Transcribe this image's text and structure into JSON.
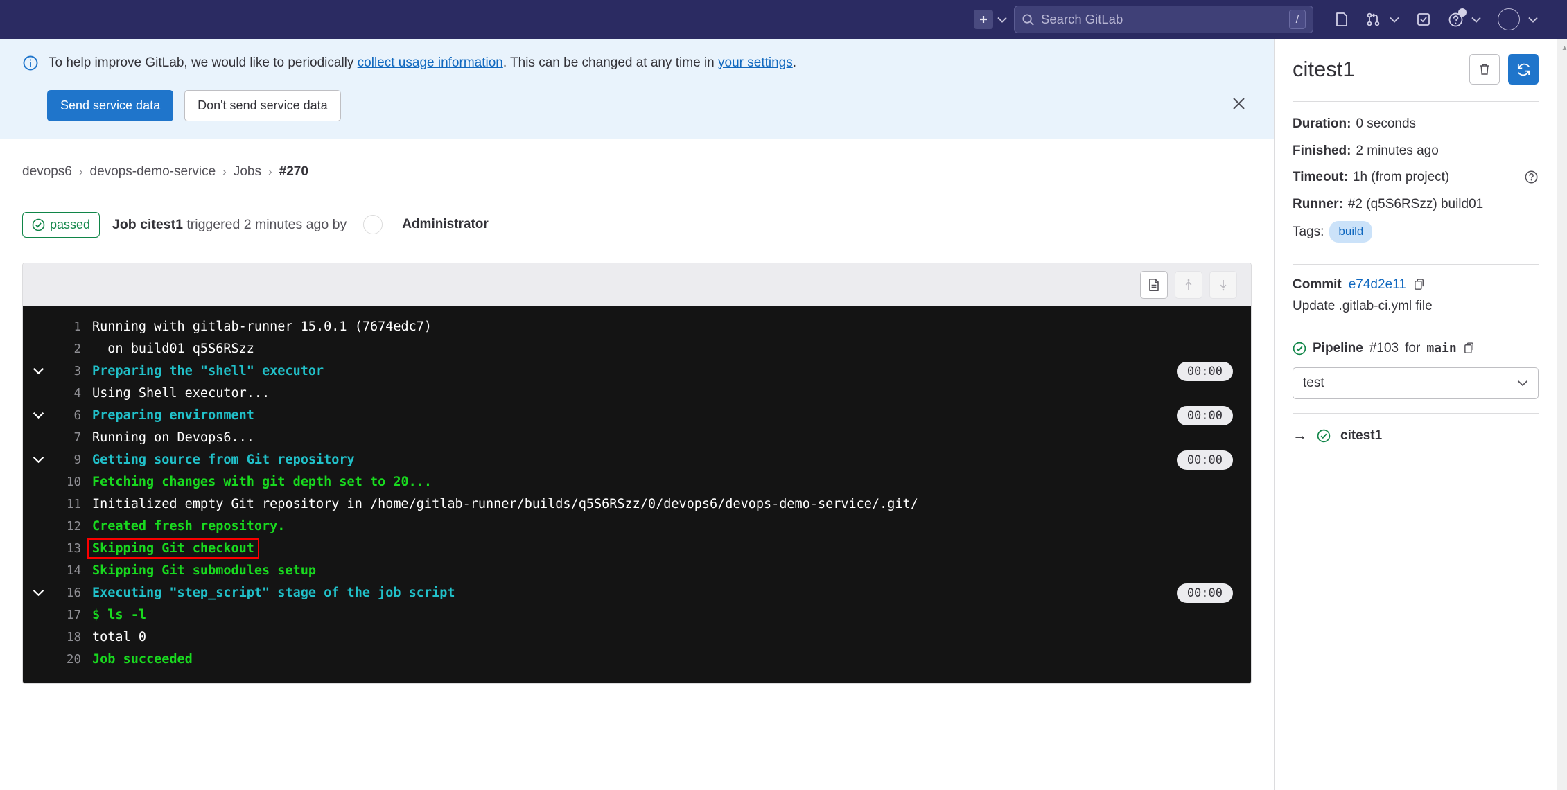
{
  "navbar": {
    "create_label": "+",
    "search_placeholder": "Search GitLab",
    "search_value": "",
    "slash_key": "/",
    "icons": [
      "create-new-icon",
      "issues-icon",
      "merge-requests-icon",
      "todos-icon",
      "help-icon",
      "user-avatar-icon"
    ]
  },
  "alert": {
    "text_before": "To help improve GitLab, we would like to periodically ",
    "link1": "collect usage information",
    "text_middle": ". This can be changed at any time in ",
    "link2": "your settings",
    "text_after": ".",
    "primary_button": "Send service data",
    "secondary_button": "Don't send service data"
  },
  "breadcrumb": {
    "items": [
      {
        "label": "devops6"
      },
      {
        "label": "devops-demo-service"
      },
      {
        "label": "Jobs"
      },
      {
        "label": "#270"
      }
    ],
    "separator": "›"
  },
  "job_header": {
    "status": "passed",
    "title_bold": "Job citest1",
    "title_rest": " triggered 2 minutes ago by",
    "user": "Administrator"
  },
  "log_toolbar": {
    "raw_label": "raw-log-icon",
    "scroll_top_label": "scroll-to-top-icon",
    "scroll_bottom_label": "scroll-to-bottom-icon"
  },
  "log": {
    "lines": [
      {
        "num": "1",
        "text": "Running with gitlab-runner 15.0.1 (7674edc7)",
        "color": "white",
        "collapsible": false,
        "time": ""
      },
      {
        "num": "2",
        "text": "  on build01 q5S6RSzz",
        "color": "white",
        "collapsible": false,
        "time": ""
      },
      {
        "num": "3",
        "text": "Preparing the \"shell\" executor",
        "color": "cyan",
        "collapsible": true,
        "time": "00:00"
      },
      {
        "num": "4",
        "text": "Using Shell executor...",
        "color": "white",
        "collapsible": false,
        "time": ""
      },
      {
        "num": "6",
        "text": "Preparing environment",
        "color": "cyan",
        "collapsible": true,
        "time": "00:00"
      },
      {
        "num": "7",
        "text": "Running on Devops6...",
        "color": "white",
        "collapsible": false,
        "time": ""
      },
      {
        "num": "9",
        "text": "Getting source from Git repository",
        "color": "cyan",
        "collapsible": true,
        "time": "00:00"
      },
      {
        "num": "10",
        "text": "Fetching changes with git depth set to 20...",
        "color": "green",
        "collapsible": false,
        "time": ""
      },
      {
        "num": "11",
        "text": "Initialized empty Git repository in /home/gitlab-runner/builds/q5S6RSzz/0/devops6/devops-demo-service/.git/",
        "color": "white",
        "collapsible": false,
        "time": ""
      },
      {
        "num": "12",
        "text": "Created fresh repository.",
        "color": "green",
        "collapsible": false,
        "time": ""
      },
      {
        "num": "13",
        "text": "Skipping Git checkout",
        "color": "green",
        "collapsible": false,
        "time": "",
        "highlighted": true
      },
      {
        "num": "14",
        "text": "Skipping Git submodules setup",
        "color": "green",
        "collapsible": false,
        "time": ""
      },
      {
        "num": "16",
        "text": "Executing \"step_script\" stage of the job script",
        "color": "cyan",
        "collapsible": true,
        "time": "00:00"
      },
      {
        "num": "17",
        "text": "$ ls -l",
        "color": "green",
        "collapsible": false,
        "time": ""
      },
      {
        "num": "18",
        "text": "total 0",
        "color": "white",
        "collapsible": false,
        "time": ""
      },
      {
        "num": "20",
        "text": "Job succeeded",
        "color": "green",
        "collapsible": false,
        "time": ""
      }
    ]
  },
  "sidebar": {
    "title": "citest1",
    "erase_button": "erase-job-icon",
    "retry_button": "retry-job-icon",
    "details": [
      {
        "label": "Duration:",
        "value": "0 seconds",
        "help": false
      },
      {
        "label": "Finished:",
        "value": "2 minutes ago",
        "help": false
      },
      {
        "label": "Timeout:",
        "value": "1h (from project)",
        "help": true
      },
      {
        "label": "Runner:",
        "value": "#2 (q5S6RSzz) build01",
        "help": false
      }
    ],
    "tags_label": "Tags:",
    "tags": [
      "build"
    ],
    "commit_label": "Commit",
    "commit_sha": "e74d2e11",
    "commit_message": "Update .gitlab-ci.yml file",
    "pipeline_label": "Pipeline",
    "pipeline_number": "#103",
    "pipeline_for": "for",
    "pipeline_ref": "main",
    "stage_selected": "test",
    "stage_options": [
      "test"
    ],
    "jobs": [
      {
        "name": "citest1",
        "status": "passed"
      }
    ]
  },
  "colors": {
    "nav_bg": "#2b2b62",
    "accent_blue": "#1f75cb",
    "success_green": "#108548",
    "log_bg": "#141414",
    "log_cyan": "#21c0c9",
    "log_green": "#19d91f",
    "highlight_red": "#fb0000"
  }
}
